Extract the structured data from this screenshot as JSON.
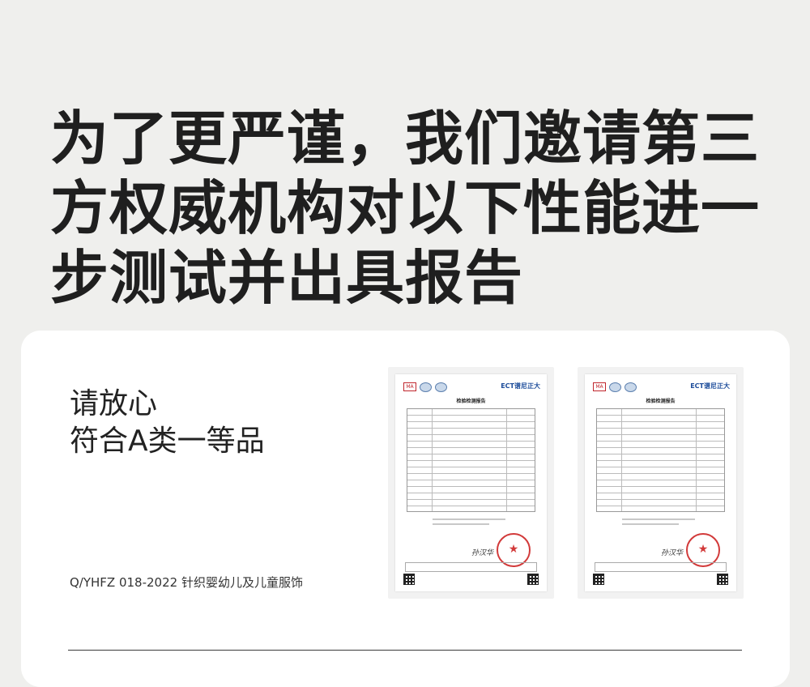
{
  "headline": "为了更严谨，我们邀请第三方权威机构对以下性能进一步测试并出具报告",
  "card": {
    "title_line1": "请放心",
    "title_line2": "符合A类一等品",
    "standard": "Q/YHFZ 018-2022 针织婴幼儿及儿童服饰"
  },
  "reports": [
    {
      "brand": "ECT谱尼正大",
      "title": "检验检测报告",
      "logo_text": "MA",
      "stamp_glyph": "★",
      "signature": "孙汉华"
    },
    {
      "brand": "ECT谱尼正大",
      "title": "检验检测报告",
      "logo_text": "MA",
      "stamp_glyph": "★",
      "signature": "孙汉华"
    }
  ],
  "colors": {
    "background": "#efefed",
    "card": "#ffffff",
    "text": "#1f1f1f",
    "stamp": "#d23a3a",
    "brand": "#1c4c9a"
  }
}
